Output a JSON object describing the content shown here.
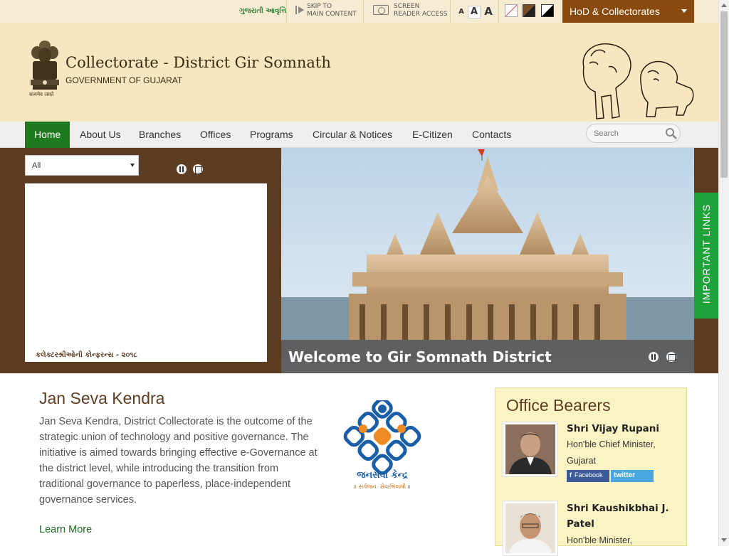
{
  "topbar": {
    "language_link": "ગુજરાતી આવૃત્તિ",
    "skip_line1": "SKIP TO",
    "skip_line2": "MAIN CONTENT",
    "screen_line1": "SCREEN",
    "screen_line2": "READER ACCESS",
    "font_small": "A",
    "font_normal": "A",
    "font_large": "A",
    "hod_label": "HoD & Collectorates"
  },
  "header": {
    "title": "Collectorate - District Gir Somnath",
    "subtitle": "GOVERNMENT OF GUJARAT",
    "emblem_motto": "सत्यमेव जयते"
  },
  "nav": {
    "items": [
      "Home",
      "About Us",
      "Branches",
      "Offices",
      "Programs",
      "Circular & Notices",
      "E-Citizen",
      "Contacts"
    ],
    "active": "Home",
    "search_placeholder": "Search"
  },
  "news": {
    "filter_value": "All",
    "ticker_text": "કલેક્ટરશ્રીઓની કોન્ફરન્સ - ૨૦૧૮"
  },
  "hero": {
    "caption": "Welcome to Gir Somnath District"
  },
  "important_links": "IMPORTANT LINKS",
  "jan_seva": {
    "title": "Jan Seva Kendra",
    "text": "Jan Seva Kendra, District Collectorate is the outcome of the strategic union of technology and positive governance. The initiative is aimed towards bringing effective e-Governance at the district level, while introducing the transition from traditional governance to paperless, place-independent governance services.",
    "more_label": "Learn More",
    "logo_text": "જનસેવા કેન્દ્ર",
    "logo_tagline": "॥ સર્વજનઃ સેવાભિલાષી ॥"
  },
  "office_bearers": {
    "title": "Office Bearers",
    "people": [
      {
        "name": "Shri Vijay Rupani",
        "role": "Hon'ble Chief Minister, Gujarat"
      },
      {
        "name": "Shri Kaushikbhai J. Patel",
        "role": "Hon'ble Minister,"
      }
    ],
    "facebook_label": "Facebook",
    "twitter_label": "twitter"
  },
  "colors": {
    "brand_brown": "#5c3d21",
    "header_bg": "#f8e6c0",
    "nav_active": "#1e7a1e",
    "important_links": "#1ea23a",
    "hod_bg": "#8a4a0f"
  }
}
